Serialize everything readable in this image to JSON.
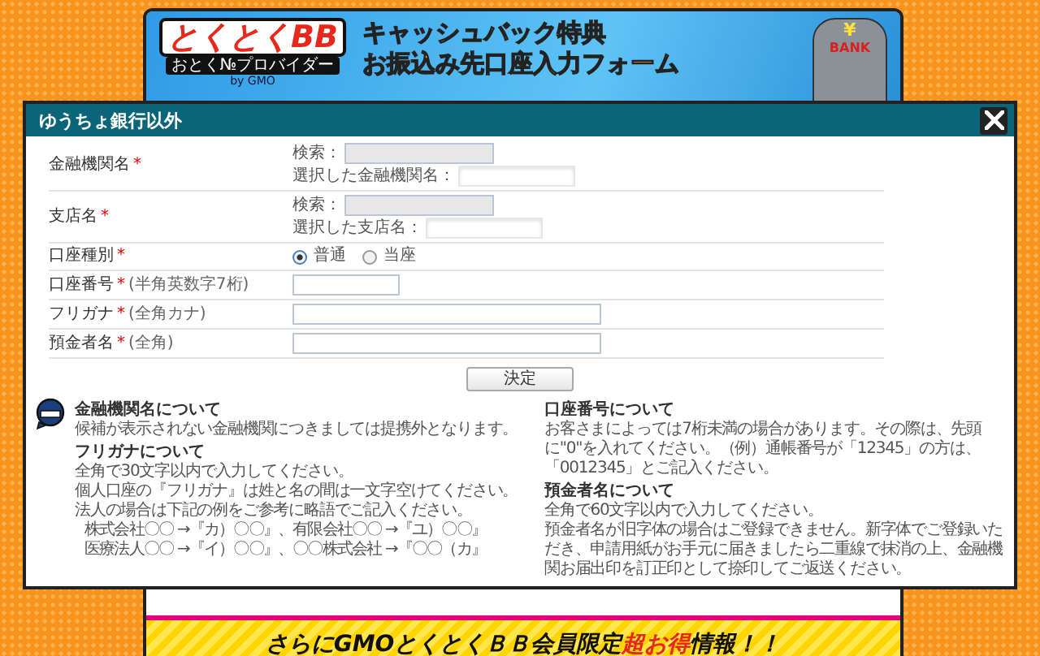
{
  "header": {
    "logo": "とくとくBB",
    "logo_tagline": "おとく№プロバイダー",
    "logo_by": "by GMO",
    "title_lines": [
      "キャッシュバック特典",
      "お振込み先口座入力フォーム"
    ],
    "bank_sign": "BANK",
    "bank_symbol": "¥"
  },
  "modal": {
    "title": "ゆうちょ銀行以外",
    "fields": [
      {
        "kind": "search",
        "label": "金融機関名",
        "required_mark": "*",
        "search_label": "検索：",
        "selected_label": "選択した金融機関名："
      },
      {
        "kind": "search",
        "label": "支店名",
        "required_mark": "*",
        "search_label": "検索：",
        "selected_label": "選択した支店名："
      },
      {
        "kind": "radio",
        "label": "口座種別",
        "required_mark": "*",
        "options": [
          {
            "label": "普通",
            "selected": true
          },
          {
            "label": "当座",
            "selected": false
          }
        ]
      },
      {
        "kind": "short_text",
        "label": "口座番号",
        "required_mark": "*",
        "hint": "(半角英数字7桁)"
      },
      {
        "kind": "text",
        "label": "フリガナ",
        "required_mark": "*",
        "hint": "(全角カナ)"
      },
      {
        "kind": "text",
        "label": "預金者名",
        "required_mark": "*",
        "hint": "(全角)"
      }
    ],
    "submit": "決定",
    "note_columns": [
      [
        {
          "title": "金融機関名について",
          "lines": [
            "候補が表示されない金融機関につきましては提携外となります。"
          ]
        },
        {
          "title": "フリガナについて",
          "lines": [
            "全角で30文字以内で入力してください。",
            "個人口座の『フリガナ』は姓と名の間は一文字空けてください。",
            "法人の場合は下記の例をご参考に略語でご記入ください。"
          ],
          "examples": [
            "株式会社〇〇 →『カ）〇〇』、有限会社〇〇 →『ユ）〇〇』",
            "医療法人〇〇 →『イ）〇〇』、〇〇株式会社 →『〇〇（カ』"
          ]
        }
      ],
      [
        {
          "title": "口座番号について",
          "lines": [
            "お客さまによっては7桁未満の場合があります。その際は、先頭に\"0\"を入れてください。（例）通帳番号が「12345」の方は、「0012345」とご記入ください。"
          ]
        },
        {
          "title": "預金者名について",
          "lines": [
            "全角で60文字以内で入力してください。",
            "預金者名が旧字体の場合はご登録できません。新字体でご登録いただき、申請用紙がお手元に届きましたら二重線で抹消の上、金融機関お届出印を訂正印として捺印してご返送ください。"
          ]
        }
      ]
    ]
  },
  "banner": [
    {
      "text": "さらにGMOとくとくＢＢ会員限定",
      "emphasis": false
    },
    {
      "text": "超お得",
      "emphasis": true
    },
    {
      "text": "情報！！",
      "emphasis": false
    }
  ]
}
